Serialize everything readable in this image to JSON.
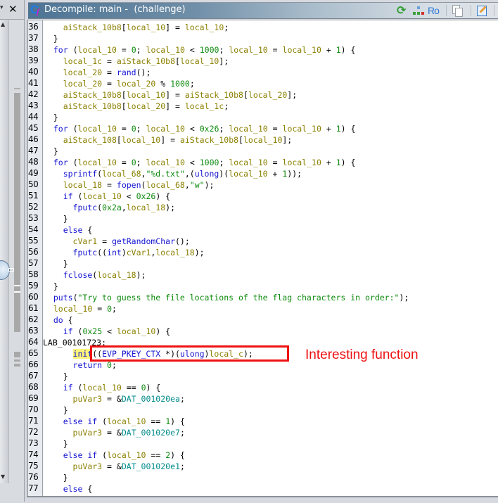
{
  "left_panel": {
    "close_label": "✕",
    "chevron_label": "▾",
    "scroll_up": "▲",
    "scroll_down": "▼"
  },
  "window": {
    "title": "Decompile: main -  (challenge)",
    "icon": "decompiler-cf-icon",
    "toolbar": [
      {
        "name": "refresh-icon",
        "glyph": "⟳"
      },
      {
        "name": "function-graph-icon",
        "glyph": ""
      },
      {
        "name": "read-only-icon",
        "glyph": "Ro"
      },
      {
        "name": "copy-icon",
        "glyph": ""
      },
      {
        "name": "edit-icon",
        "glyph": ""
      }
    ]
  },
  "code": {
    "line_numbers": [
      "36",
      "37",
      "38",
      "39",
      "40",
      "41",
      "42",
      "43",
      "44",
      "45",
      "46",
      "47",
      "48",
      "49",
      "50",
      "51",
      "52",
      "53",
      "54",
      "55",
      "56",
      "57",
      "58",
      "59",
      "60",
      "61",
      "62",
      "63",
      "64",
      "65",
      "66",
      "67",
      "68",
      "69",
      "70",
      "71",
      "72",
      "73",
      "74",
      "75",
      "76",
      "77"
    ],
    "lines": [
      [
        {
          "i": 2,
          "t": "aiStack_10b8[local_10] = local_10;",
          "c": "mix36"
        }
      ],
      [
        {
          "i": 1,
          "t": "}",
          "c": "op"
        }
      ],
      [
        {
          "i": 1,
          "t": "for (local_10 = 0; local_10 < 1000; local_10 = local_10 + 1) {",
          "c": "mix38"
        }
      ],
      [
        {
          "i": 2,
          "t": "local_1c = aiStack_10b8[local_10];",
          "c": "var"
        }
      ],
      [
        {
          "i": 2,
          "t": "local_20 = rand();",
          "c": "mix40"
        }
      ],
      [
        {
          "i": 2,
          "t": "local_20 = local_20 % 1000;",
          "c": "mix41"
        }
      ],
      [
        {
          "i": 2,
          "t": "aiStack_10b8[local_10] = aiStack_10b8[local_20];",
          "c": "var"
        }
      ],
      [
        {
          "i": 2,
          "t": "aiStack_10b8[local_20] = local_1c;",
          "c": "var"
        }
      ],
      [
        {
          "i": 1,
          "t": "}",
          "c": "op"
        }
      ],
      [
        {
          "i": 1,
          "t": "for (local_10 = 0; local_10 < 0x26; local_10 = local_10 + 1) {",
          "c": "mix45"
        }
      ],
      [
        {
          "i": 2,
          "t": "aiStack_108[local_10] = aiStack_10b8[local_10];",
          "c": "var"
        }
      ],
      [
        {
          "i": 1,
          "t": "}",
          "c": "op"
        }
      ],
      [
        {
          "i": 1,
          "t": "for (local_10 = 0; local_10 < 1000; local_10 = local_10 + 1) {",
          "c": "mix38"
        }
      ],
      [
        {
          "i": 2,
          "t": "sprintf(local_68,\"%d.txt\",(ulong)(local_10 + 1));",
          "c": "mix49"
        }
      ],
      [
        {
          "i": 2,
          "t": "local_18 = fopen(local_68,\"w\");",
          "c": "mix50"
        }
      ],
      [
        {
          "i": 2,
          "t": "if (local_10 < 0x26) {",
          "c": "mix51"
        }
      ],
      [
        {
          "i": 3,
          "t": "fputc(0x2a,local_18);",
          "c": "mix52"
        }
      ],
      [
        {
          "i": 2,
          "t": "}",
          "c": "op"
        }
      ],
      [
        {
          "i": 2,
          "t": "else {",
          "c": "mix54"
        }
      ],
      [
        {
          "i": 3,
          "t": "cVar1 = getRandomChar();",
          "c": "mix55"
        }
      ],
      [
        {
          "i": 3,
          "t": "fputc((int)cVar1,local_18);",
          "c": "mix56"
        }
      ],
      [
        {
          "i": 2,
          "t": "}",
          "c": "op"
        }
      ],
      [
        {
          "i": 2,
          "t": "fclose(local_18);",
          "c": "mix58"
        }
      ],
      [
        {
          "i": 1,
          "t": "}",
          "c": "op"
        }
      ],
      [
        {
          "i": 1,
          "t": "puts(\"Try to guess the file locations of the flag characters in order:\");",
          "c": "mix60"
        }
      ],
      [
        {
          "i": 1,
          "t": "local_10 = 0;",
          "c": "mix61"
        }
      ],
      [
        {
          "i": 1,
          "t": "do {",
          "c": "mix62"
        }
      ],
      [
        {
          "i": 2,
          "t": "if (0x25 < local_10) {",
          "c": "mix63"
        }
      ],
      [
        {
          "i": 0,
          "t": "LAB_00101723:",
          "c": "lab"
        }
      ],
      [
        {
          "i": 3,
          "t": "init((EVP_PKEY_CTX *)(ulong)local_c);",
          "c": "mix65"
        }
      ],
      [
        {
          "i": 3,
          "t": "return 0;",
          "c": "mix66"
        }
      ],
      [
        {
          "i": 2,
          "t": "}",
          "c": "op"
        }
      ],
      [
        {
          "i": 2,
          "t": "if (local_10 == 0) {",
          "c": "mix68"
        }
      ],
      [
        {
          "i": 3,
          "t": "puVar3 = &DAT_001020ea;",
          "c": "mix69"
        }
      ],
      [
        {
          "i": 2,
          "t": "}",
          "c": "op"
        }
      ],
      [
        {
          "i": 2,
          "t": "else if (local_10 == 1) {",
          "c": "mix71"
        }
      ],
      [
        {
          "i": 3,
          "t": "puVar3 = &DAT_001020e7;",
          "c": "mix69"
        }
      ],
      [
        {
          "i": 2,
          "t": "}",
          "c": "op"
        }
      ],
      [
        {
          "i": 2,
          "t": "else if (local_10 == 2) {",
          "c": "mix71"
        }
      ],
      [
        {
          "i": 3,
          "t": "puVar3 = &DAT_001020e1;",
          "c": "mix69"
        }
      ],
      [
        {
          "i": 2,
          "t": "}",
          "c": "op"
        }
      ],
      [
        {
          "i": 2,
          "t": "else {",
          "c": "mix54"
        }
      ]
    ],
    "highlighted_token": "init"
  },
  "annotation": {
    "text": "Interesting function",
    "color": "#ee1111"
  },
  "colors": {
    "variable": "#8b8000",
    "keyword": "#1414d2",
    "constant": "#0d8a0d",
    "data_ref": "#008b8b",
    "highlight": "#fdf57a"
  }
}
